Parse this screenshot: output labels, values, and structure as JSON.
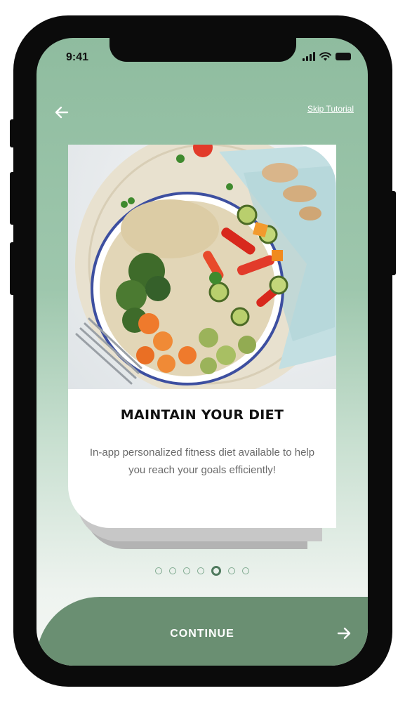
{
  "status_bar": {
    "time": "9:41"
  },
  "header": {
    "skip_label": "Skip Tutorial"
  },
  "card": {
    "title": "MAINTAIN YOUR DIET",
    "description": "In-app personalized fitness diet available to help you reach your goals efficiently!"
  },
  "pagination": {
    "total": 7,
    "active_index": 4
  },
  "footer": {
    "continue_label": "CONTINUE"
  },
  "colors": {
    "screen_top": "#8fbc9f",
    "continue_bar": "#6a8f72",
    "dot_active": "#4f7a5e",
    "dot_inactive": "#7fa98f"
  },
  "icons": {
    "back": "arrow-left-icon",
    "next": "arrow-right-icon",
    "signal": "cellular-signal-icon",
    "wifi": "wifi-icon",
    "battery": "battery-icon"
  }
}
